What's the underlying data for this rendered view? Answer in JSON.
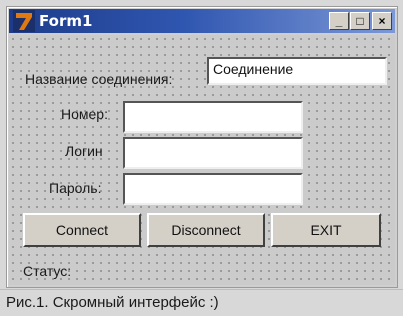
{
  "window": {
    "title": "Form1",
    "controls": {
      "minimize": "_",
      "maximize": "□",
      "close": "×"
    }
  },
  "form": {
    "connection_name_label": "Название соединения:",
    "connection_name_value": "Соединение",
    "number_label": "Номер:",
    "number_value": "",
    "login_label": "Логин",
    "login_value": "",
    "password_label": "Пароль:",
    "password_value": ""
  },
  "buttons": {
    "connect": "Connect",
    "disconnect": "Disconnect",
    "exit": "EXIT"
  },
  "status": {
    "label": "Статус:"
  },
  "caption": "Рис.1. Скромный интерфейс :)",
  "colors": {
    "titlebar_start": "#1e3c8a",
    "titlebar_end": "#7c98d6",
    "logo_orange": "#e07a10"
  }
}
